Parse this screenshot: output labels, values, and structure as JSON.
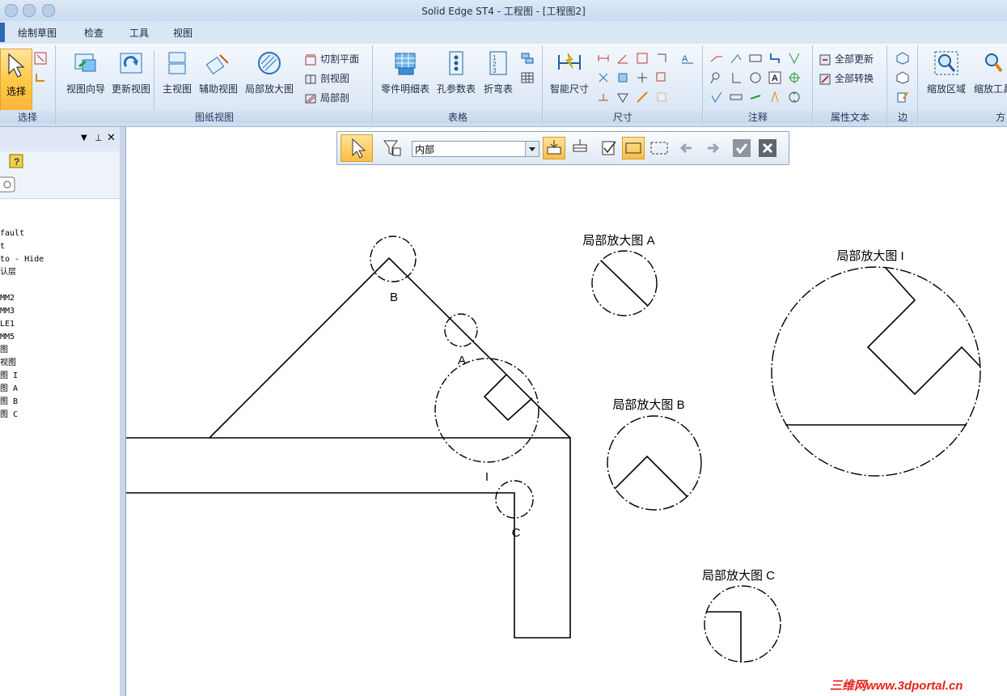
{
  "window": {
    "title": "Solid Edge ST4 - 工程图 - [工程图2]"
  },
  "tabs": [
    "绘制草图",
    "检查",
    "工具",
    "视图"
  ],
  "ribbon": {
    "select": {
      "button": "选择",
      "group": "选择"
    },
    "drawing_views": {
      "group": "图纸视图",
      "buttons": [
        "视图向导",
        "更新视图",
        "主视图",
        "辅助视图",
        "局部放大图"
      ],
      "small": [
        "切割平面",
        "剖视图",
        "局部剖"
      ]
    },
    "tables": {
      "group": "表格",
      "buttons": [
        "零件明细表",
        "孔参数表",
        "折弯表"
      ]
    },
    "dimension": {
      "group": "尺寸",
      "buttons": [
        "智能尺寸"
      ]
    },
    "annotation": {
      "group": "注释"
    },
    "property_text": {
      "group": "属性文本",
      "small": [
        "全部更新",
        "全部转换"
      ]
    },
    "edges": {
      "group": "边"
    },
    "zoom": {
      "group": "方",
      "buttons": [
        "缩放区域",
        "缩放工具"
      ]
    }
  },
  "left_pane": {
    "tree": [
      "fault",
      "t",
      "to - Hide",
      "认层",
      "",
      "MM2",
      "MM3",
      "LE1",
      "MM5",
      "图",
      "视图",
      "图 I",
      "图 A",
      "图 B",
      "图 C"
    ]
  },
  "command_bar": {
    "combo_value": "内部"
  },
  "drawing": {
    "callouts": [
      "A",
      "B",
      "C",
      "I"
    ],
    "detail_titles": [
      "局部放大图 A",
      "局部放大图 B",
      "局部放大图 C",
      "局部放大图 I"
    ]
  },
  "watermark": "三维网www.3dportal.cn"
}
